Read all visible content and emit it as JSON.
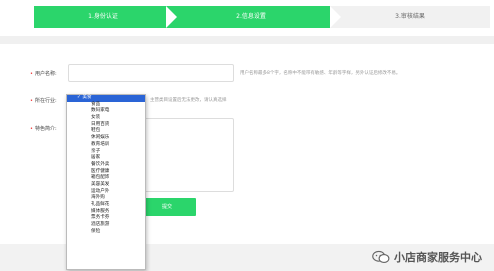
{
  "steps": [
    {
      "label": "1.身份认证"
    },
    {
      "label": "2.信息设置"
    },
    {
      "label": "3.审核结果"
    }
  ],
  "form": {
    "name_label": "用户名称:",
    "name_value": "",
    "name_hint": "用户名称最多8个字，名称中不能带有敏感、年龄等字样，另外认证后修改不易。",
    "industry_label": "所在行业:",
    "industry_selected": "美食",
    "industry_hint": "主营类目设置后无法更改，请认真选择",
    "intro_label": "特色简介:",
    "intro_value": "",
    "submit_label": "提交"
  },
  "industry_options": [
    "美食",
    "食品",
    "数码家电",
    "女装",
    "日用百货",
    "鞋包",
    "休闲娱乐",
    "教育培训",
    "亲子",
    "居家",
    "餐饮外卖",
    "医疗健康",
    "箱包配饰",
    "美容美发",
    "运动户外",
    "海外购",
    "礼品鲜花",
    "媒体服务",
    "票务卡券",
    "酒店旅游",
    "保险"
  ],
  "watermark": {
    "text": "小店商家服务中心"
  },
  "colors": {
    "accent": "#2bd56b",
    "selected": "#2a64d6",
    "required": "#e33333"
  }
}
